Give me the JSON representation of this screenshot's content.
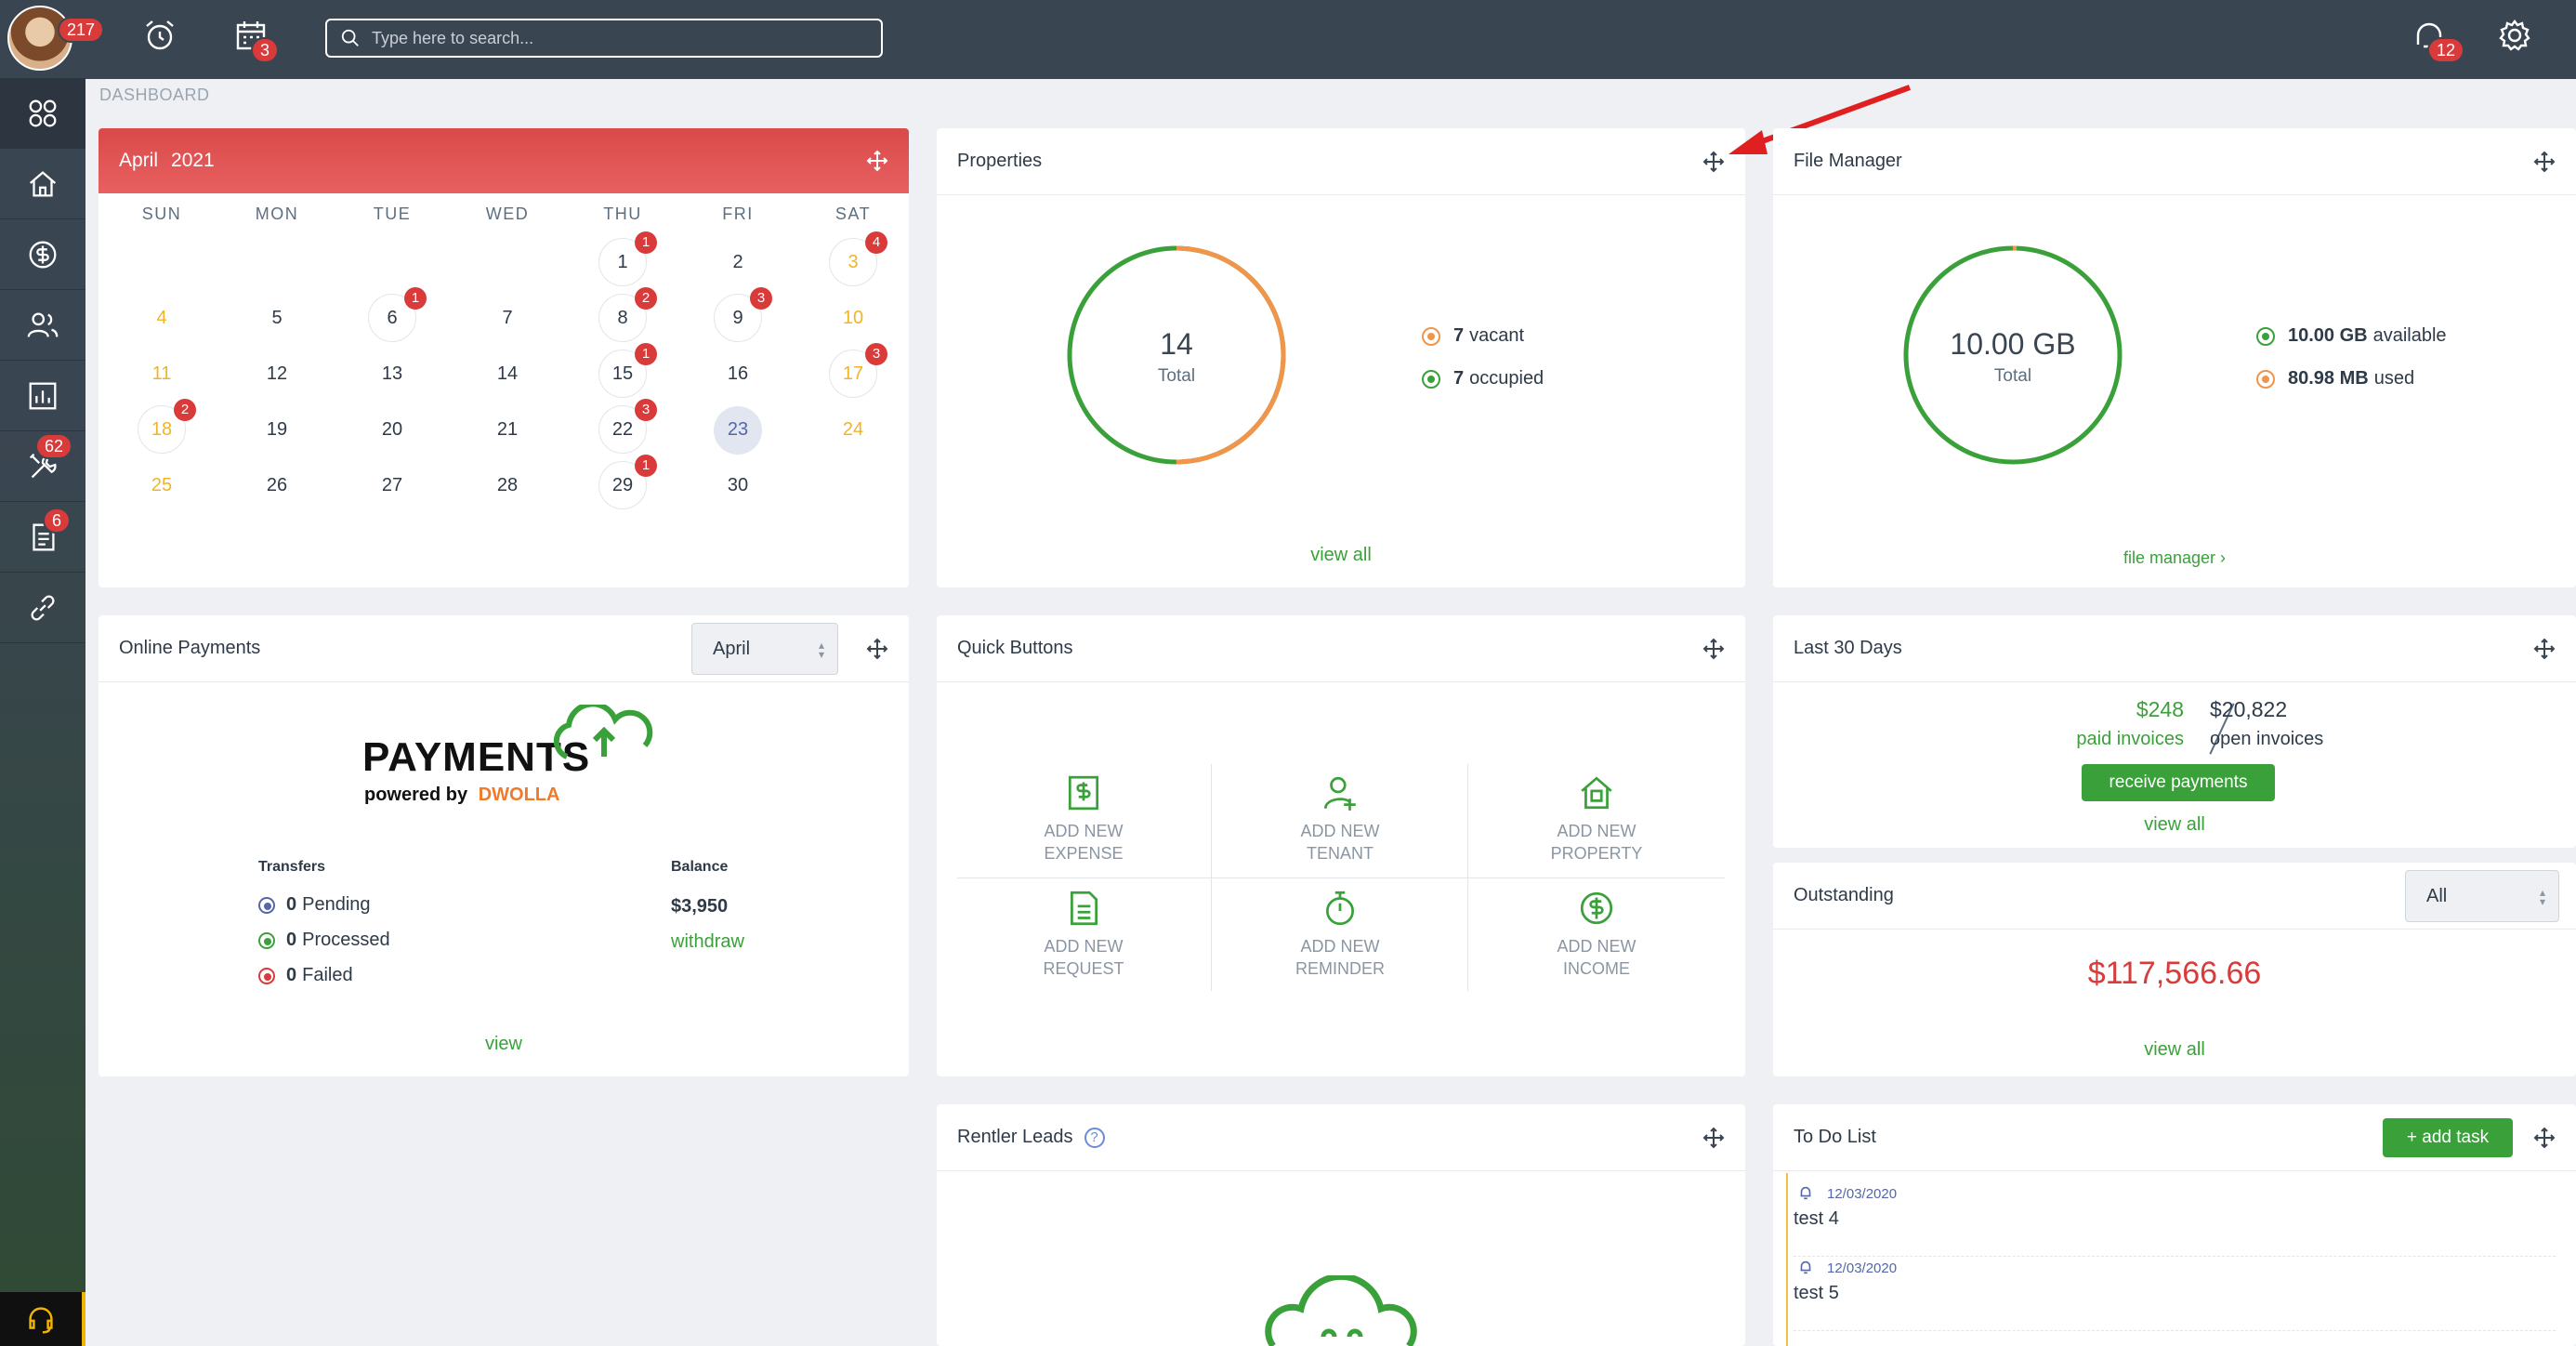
{
  "topbar": {
    "alerts_badge": "217",
    "calendar_badge": "3",
    "search_placeholder": "Type here to search...",
    "chat_badge": "12"
  },
  "sidebar": {
    "tools_badge": "62",
    "docs_badge": "6"
  },
  "breadcrumb": "DASHBOARD",
  "calendar": {
    "month": "April",
    "year": "2021",
    "weekdays": [
      "SUN",
      "MON",
      "TUE",
      "WED",
      "THU",
      "FRI",
      "SAT"
    ],
    "weeks": [
      [
        {
          "d": ""
        },
        {
          "d": ""
        },
        {
          "d": ""
        },
        {
          "d": ""
        },
        {
          "d": "1",
          "b": "1"
        },
        {
          "d": "2"
        },
        {
          "d": "3",
          "b": "4"
        }
      ],
      [
        {
          "d": "4"
        },
        {
          "d": "5"
        },
        {
          "d": "6",
          "b": "1"
        },
        {
          "d": "7"
        },
        {
          "d": "8",
          "b": "2"
        },
        {
          "d": "9",
          "b": "3"
        },
        {
          "d": "10"
        }
      ],
      [
        {
          "d": "11"
        },
        {
          "d": "12"
        },
        {
          "d": "13"
        },
        {
          "d": "14"
        },
        {
          "d": "15",
          "b": "1"
        },
        {
          "d": "16"
        },
        {
          "d": "17",
          "b": "3"
        }
      ],
      [
        {
          "d": "18",
          "b": "2"
        },
        {
          "d": "19"
        },
        {
          "d": "20"
        },
        {
          "d": "21"
        },
        {
          "d": "22",
          "b": "3"
        },
        {
          "d": "23",
          "today": true
        },
        {
          "d": "24"
        }
      ],
      [
        {
          "d": "25"
        },
        {
          "d": "26"
        },
        {
          "d": "27"
        },
        {
          "d": "28"
        },
        {
          "d": "29",
          "b": "1"
        },
        {
          "d": "30"
        },
        {
          "d": ""
        }
      ]
    ]
  },
  "properties": {
    "title": "Properties",
    "total_value": "14",
    "total_label": "Total",
    "vacant_count": "7",
    "vacant_label": "vacant",
    "occupied_count": "7",
    "occupied_label": "occupied",
    "vacant_fraction": 0.5,
    "view_all": "view all"
  },
  "file_manager": {
    "title": "File Manager",
    "total_value": "10.00 GB",
    "total_label": "Total",
    "available_value": "10.00 GB",
    "available_label": "available",
    "used_value": "80.98 MB",
    "used_label": "used",
    "link": "file manager"
  },
  "online_payments": {
    "title": "Online Payments",
    "month_select": "April",
    "logo_text": "PAYMENTS",
    "powered_by": "powered by",
    "dwolla": "DWOLLA",
    "transfers_header": "Transfers",
    "balance_header": "Balance",
    "pending_count": "0",
    "pending_label": "Pending",
    "processed_count": "0",
    "processed_label": "Processed",
    "failed_count": "0",
    "failed_label": "Failed",
    "balance_value": "$3,950",
    "withdraw": "withdraw",
    "view": "view"
  },
  "quick_buttons": {
    "title": "Quick Buttons",
    "items": [
      {
        "line1": "ADD NEW",
        "line2": "EXPENSE"
      },
      {
        "line1": "ADD NEW",
        "line2": "TENANT"
      },
      {
        "line1": "ADD NEW",
        "line2": "PROPERTY"
      },
      {
        "line1": "ADD NEW",
        "line2": "REQUEST"
      },
      {
        "line1": "ADD NEW",
        "line2": "REMINDER"
      },
      {
        "line1": "ADD NEW",
        "line2": "INCOME"
      }
    ]
  },
  "last30": {
    "title": "Last 30 Days",
    "paid_amount": "$248",
    "paid_label": "paid invoices",
    "open_amount": "$20,822",
    "open_label": "open invoices",
    "receive_button": "receive payments",
    "view_all": "view all"
  },
  "outstanding": {
    "title": "Outstanding",
    "filter": "All",
    "amount": "$117,566.66",
    "view_all": "view all"
  },
  "rentler": {
    "title": "Rentler Leads"
  },
  "todo": {
    "title": "To Do List",
    "add_button": "+ add task",
    "items": [
      {
        "date": "12/03/2020",
        "text": "test 4"
      },
      {
        "date": "12/03/2020",
        "text": "test 5"
      }
    ]
  },
  "colors": {
    "accent_green": "#3aa13a",
    "vacant_orange": "#f0954a",
    "calendar_red": "#d94a4a",
    "outstanding_red": "#d93a3a"
  }
}
